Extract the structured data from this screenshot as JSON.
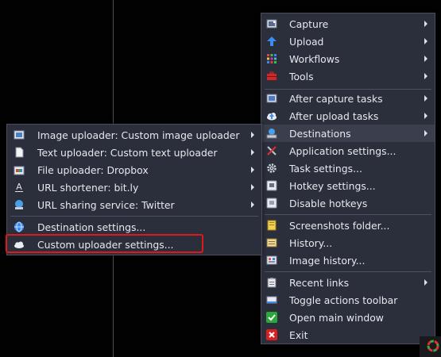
{
  "main_menu": {
    "items": [
      {
        "label": "Capture",
        "icon": "camera-icon",
        "submenu": true
      },
      {
        "label": "Upload",
        "icon": "upload-arrow-icon",
        "submenu": true
      },
      {
        "label": "Workflows",
        "icon": "workflow-grid-icon",
        "submenu": true
      },
      {
        "label": "Tools",
        "icon": "toolbox-icon",
        "submenu": true
      },
      {
        "label": "After capture tasks",
        "icon": "after-capture-icon",
        "submenu": true
      },
      {
        "label": "After upload tasks",
        "icon": "cloud-upload-icon",
        "submenu": true
      },
      {
        "label": "Destinations",
        "icon": "destinations-icon",
        "submenu": true
      },
      {
        "label": "Application settings...",
        "icon": "wrench-screwdriver-icon",
        "submenu": false
      },
      {
        "label": "Task settings...",
        "icon": "gear-icon",
        "submenu": false
      },
      {
        "label": "Hotkey settings...",
        "icon": "keyboard-icon",
        "submenu": false
      },
      {
        "label": "Disable hotkeys",
        "icon": "keyboard-disabled-icon",
        "submenu": false
      },
      {
        "label": "Screenshots folder...",
        "icon": "folder-icon",
        "submenu": false
      },
      {
        "label": "History...",
        "icon": "history-icon",
        "submenu": false
      },
      {
        "label": "Image history...",
        "icon": "image-history-icon",
        "submenu": false
      },
      {
        "label": "Recent links",
        "icon": "clipboard-icon",
        "submenu": true
      },
      {
        "label": "Toggle actions toolbar",
        "icon": "toolbar-icon",
        "submenu": false
      },
      {
        "label": "Open main window",
        "icon": "checkmark-icon",
        "submenu": false
      },
      {
        "label": "Exit",
        "icon": "close-icon",
        "submenu": false
      }
    ]
  },
  "sub_menu": {
    "items": [
      {
        "label": "Image uploader: Custom image uploader",
        "icon": "image-uploader-icon",
        "submenu": true
      },
      {
        "label": "Text uploader: Custom text uploader",
        "icon": "text-document-icon",
        "submenu": true
      },
      {
        "label": "File uploader: Dropbox",
        "icon": "file-uploader-icon",
        "submenu": true
      },
      {
        "label": "URL shortener: bit.ly",
        "icon": "url-shortener-icon",
        "submenu": true
      },
      {
        "label": "URL sharing service: Twitter",
        "icon": "sharing-globe-icon",
        "submenu": true
      },
      {
        "label": "Destination settings...",
        "icon": "globe-settings-icon",
        "submenu": false
      },
      {
        "label": "Custom uploader settings...",
        "icon": "cloud-icon",
        "submenu": false
      }
    ]
  },
  "colors": {
    "menu_bg": "#2b2e3b",
    "hover_bg": "#3a3e4d",
    "highlight": "#dd1a1a"
  }
}
